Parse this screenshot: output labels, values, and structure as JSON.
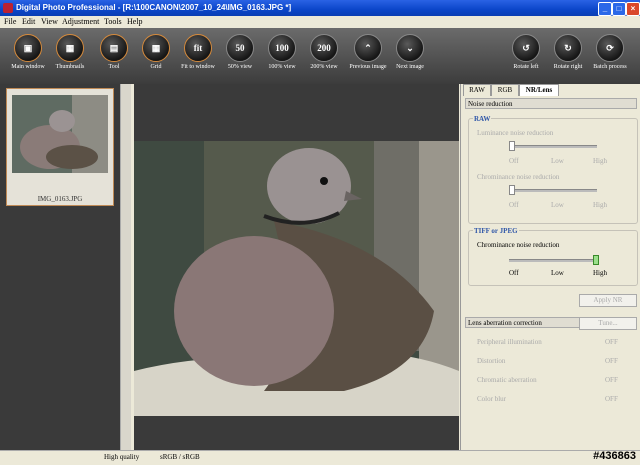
{
  "window": {
    "title": "Digital Photo Professional - [R:\\100CANON\\2007_10_24\\IMG_0163.JPG *]"
  },
  "menu": [
    "File",
    "Edit",
    "View",
    "Adjustment",
    "Tools",
    "Help"
  ],
  "toolbar": [
    {
      "label": "Main window",
      "glyph": "▣",
      "icon": "main-window-icon"
    },
    {
      "label": "Thumbnails",
      "glyph": "▦",
      "icon": "thumbnails-icon"
    },
    {
      "label": "Tool",
      "glyph": "▤",
      "icon": "tool-icon"
    },
    {
      "label": "Grid",
      "glyph": "▦",
      "icon": "grid-icon"
    },
    {
      "label": "Fit to window",
      "glyph": "fit",
      "icon": "fit-icon"
    },
    {
      "label": "50% view",
      "glyph": "50",
      "icon": "zoom-50-icon"
    },
    {
      "label": "100% view",
      "glyph": "100",
      "icon": "zoom-100-icon"
    },
    {
      "label": "200% view",
      "glyph": "200",
      "icon": "zoom-200-icon"
    },
    {
      "label": "Previous image",
      "glyph": "⌃",
      "icon": "previous-icon"
    },
    {
      "label": "Next image",
      "glyph": "⌄",
      "icon": "next-icon"
    },
    {
      "label": "Rotate left",
      "glyph": "↺",
      "icon": "rotate-left-icon"
    },
    {
      "label": "Rotate right",
      "glyph": "↻",
      "icon": "rotate-right-icon"
    },
    {
      "label": "Batch process",
      "glyph": "⟳",
      "icon": "batch-icon"
    }
  ],
  "thumbnail": {
    "filename": "IMG_0163.JPG"
  },
  "tabs": [
    "RAW",
    "RGB",
    "NR/Lens"
  ],
  "noise": {
    "header": "Noise reduction",
    "raw_title": "RAW",
    "luminance_label": "Luminance noise reduction",
    "chrominance_label": "Chrominance noise reduction",
    "scale_off": "Off",
    "scale_low": "Low",
    "scale_high": "High",
    "tiff_title": "TIFF or JPEG",
    "tiff_chroma_label": "Chrominance noise reduction",
    "tiff_chroma_level": 1.0,
    "apply_nr": "Apply NR"
  },
  "lens": {
    "header": "Lens aberration correction",
    "tune": "Tune...",
    "rows": [
      {
        "label": "Peripheral illumination",
        "value": "OFF"
      },
      {
        "label": "Distortion",
        "value": "OFF"
      },
      {
        "label": "Chromatic aberration",
        "value": "OFF"
      },
      {
        "label": "Color blur",
        "value": "OFF"
      }
    ]
  },
  "status": {
    "quality": "High quality",
    "colorspace": "sRGB / sRGB"
  },
  "watermark": "#436863"
}
